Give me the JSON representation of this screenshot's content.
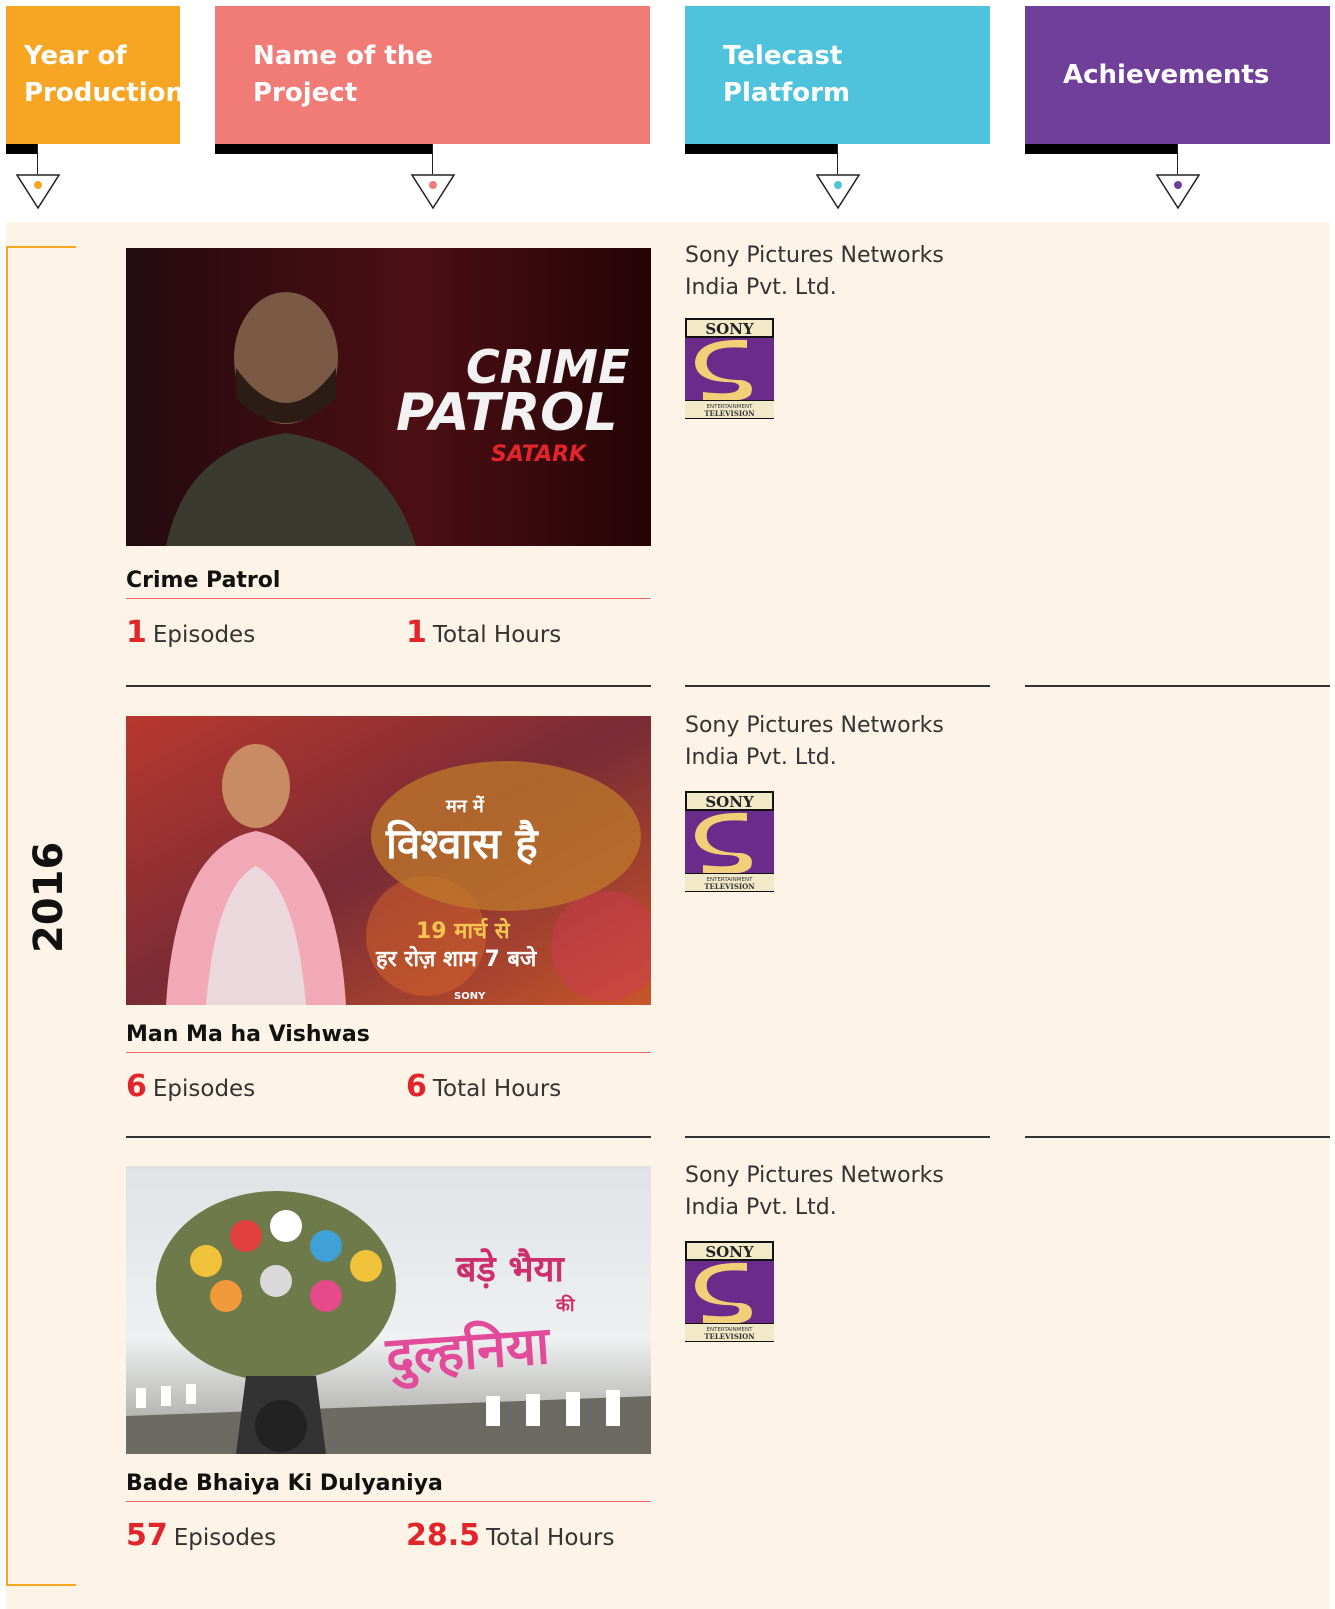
{
  "headers": {
    "year": "Year of\nProduction",
    "name": "Name of the\nProject",
    "telecast": "Telecast\nPlatform",
    "achievements": "Achievements"
  },
  "colors": {
    "year": "#F6A623",
    "name": "#F07B77",
    "telecast": "#4EC3DB",
    "achievements": "#6F3F99",
    "highlight": "#E0262A",
    "panel": "#FDF3E6"
  },
  "year_group": "2016",
  "projects": [
    {
      "title": "Crime Patrol",
      "episodes_value": "1",
      "episodes_label": "Episodes",
      "hours_value": "1",
      "hours_label": "Total Hours",
      "network": "Sony Pictures Networks India Pvt. Ltd.",
      "poster_text": [
        "CRIME",
        "PATROL",
        "SATARK"
      ]
    },
    {
      "title": "Man Ma ha Vishwas",
      "episodes_value": "6",
      "episodes_label": "Episodes",
      "hours_value": "6",
      "hours_label": "Total Hours",
      "network": "Sony Pictures Networks India Pvt. Ltd.",
      "poster_text": [
        "मन में",
        "विश्वास है",
        "19 मार्च से",
        "हर रोज़ शाम 7 बजे",
        "SONY"
      ]
    },
    {
      "title": "Bade Bhaiya Ki Dulyaniya",
      "episodes_value": "57",
      "episodes_label": "Episodes",
      "hours_value": "28.5",
      "hours_label": "Total Hours",
      "network": "Sony Pictures Networks India Pvt. Ltd.",
      "poster_text": [
        "बड़े भैया",
        "की",
        "दुल्हनिया"
      ]
    }
  ],
  "logo": {
    "top": "SONY",
    "bottom1": "ENTERTAINMENT",
    "bottom2": "TELEVISION"
  }
}
